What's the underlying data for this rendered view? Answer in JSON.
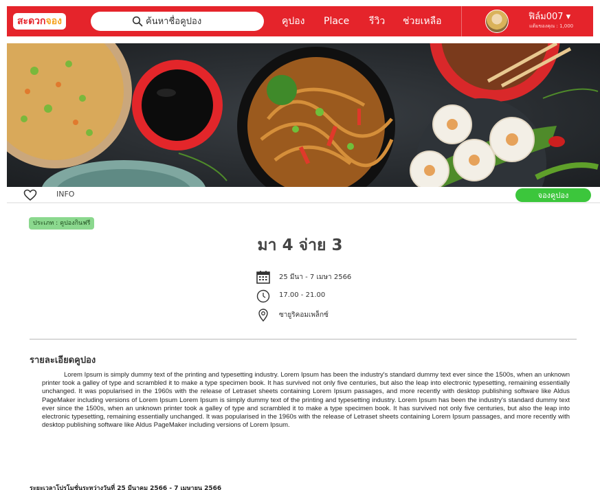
{
  "header": {
    "logo": {
      "part1": "สะดวก",
      "part2": "จอง"
    },
    "search": {
      "placeholder": "ค้นหาชื่อคูปอง",
      "icon": "search-icon"
    },
    "nav": [
      {
        "label": "คูปอง"
      },
      {
        "label": "Place"
      },
      {
        "label": "รีวิว"
      },
      {
        "label": "ช่วยเหลือ"
      }
    ],
    "user": {
      "name": "ฟิล์ม007 ▾",
      "credit": "แต้มของคุณ : 1,000"
    },
    "colors": {
      "bar": "#e5242b",
      "logo_accent": "#f6a21c"
    }
  },
  "infobar": {
    "favorite_icon": "heart-icon",
    "info_label": "INFO",
    "book_button": "จองคูปอง",
    "book_button_color": "#3cc63c"
  },
  "coupon": {
    "type_badge": "ประเภท : คูปองกินฟรี",
    "title": "มา 4 จ่าย 3",
    "date": "25 มีนา - 7 เมษา 2566",
    "time": "17.00 - 21.00",
    "location": "ซายูริคอมเพล็กซ์",
    "icons": {
      "date": "calendar-icon",
      "time": "clock-icon",
      "location": "location-pin-icon"
    }
  },
  "details": {
    "heading": "รายละเอียดคูปอง",
    "body": "Lorem Ipsum is simply dummy text of the printing and typesetting industry. Lorem Ipsum has been the industry's standard dummy text ever since the 1500s, when an unknown printer took a galley of type and scrambled it to make a type specimen book. It has survived not only five centuries, but also the leap into electronic typesetting, remaining essentially unchanged. It was popularised in the 1960s with the release of Letraset sheets containing Lorem Ipsum passages, and more recently with desktop publishing software like Aldus PageMaker including versions of Lorem Ipsum Lorem Ipsum is simply dummy text of the printing and typesetting industry. Lorem Ipsum has been the industry's standard dummy text ever since the 1500s, when an unknown printer took a galley of type and scrambled it to make a type specimen book. It has survived not only five centuries, but also the leap into electronic typesetting, remaining essentially unchanged. It was popularised in the 1960s with the release of Letraset sheets containing Lorem Ipsum passages, and more recently with desktop publishing software like Aldus PageMaker including versions of Lorem Ipsum.",
    "period": "ระยะเวลาโปรโมชั่นระหว่างวันที่ 25 มีนาคม 2566 - 7 เมษายน 2566"
  }
}
